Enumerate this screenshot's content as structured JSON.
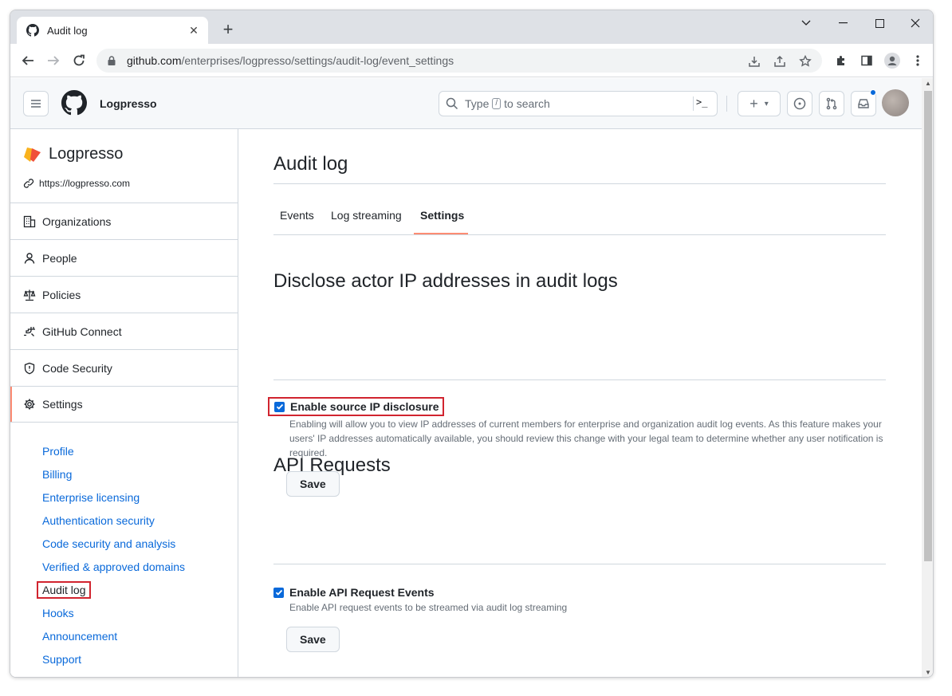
{
  "browser": {
    "tab_title": "Audit log",
    "url_host": "github.com",
    "url_path": "/enterprises/logpresso/settings/audit-log/event_settings"
  },
  "header": {
    "org_name": "Logpresso",
    "search_prefix": "Type",
    "search_key": "/",
    "search_suffix": "to search",
    "command_glyph": ">_",
    "create_plus": "+",
    "create_caret": "▾"
  },
  "sidebar": {
    "enterprise_name": "Logpresso",
    "enterprise_url": "https://logpresso.com",
    "nav": [
      {
        "label": "Organizations",
        "icon": "organization-icon"
      },
      {
        "label": "People",
        "icon": "person-icon"
      },
      {
        "label": "Policies",
        "icon": "law-icon"
      },
      {
        "label": "GitHub Connect",
        "icon": "plug-icon"
      },
      {
        "label": "Code Security",
        "icon": "shield-icon"
      },
      {
        "label": "Settings",
        "icon": "gear-icon"
      }
    ],
    "settings_sub": [
      "Profile",
      "Billing",
      "Enterprise licensing",
      "Authentication security",
      "Code security and analysis",
      "Verified & approved domains",
      "Audit log",
      "Hooks",
      "Announcement",
      "Support"
    ]
  },
  "main": {
    "title": "Audit log",
    "tabs": [
      "Events",
      "Log streaming",
      "Settings"
    ],
    "ip_section": {
      "title": "Disclose actor IP addresses in audit logs",
      "checkbox_label": "Enable source IP disclosure",
      "checked": true,
      "description": "Enabling will allow you to view IP addresses of current members for enterprise and organization audit log events. As this feature makes your users' IP addresses automatically available, you should review this change with your legal team to determine whether any user notification is required.",
      "save_label": "Save"
    },
    "api_section": {
      "title": "API Requests",
      "checkbox_label": "Enable API Request Events",
      "checked": true,
      "description": "Enable API request events to be streamed via audit log streaming",
      "save_label": "Save"
    }
  },
  "colors": {
    "link": "#0969da",
    "accent_underline": "#fd8c73",
    "highlight_box": "#d1242f",
    "checkbox": "#0969da"
  }
}
